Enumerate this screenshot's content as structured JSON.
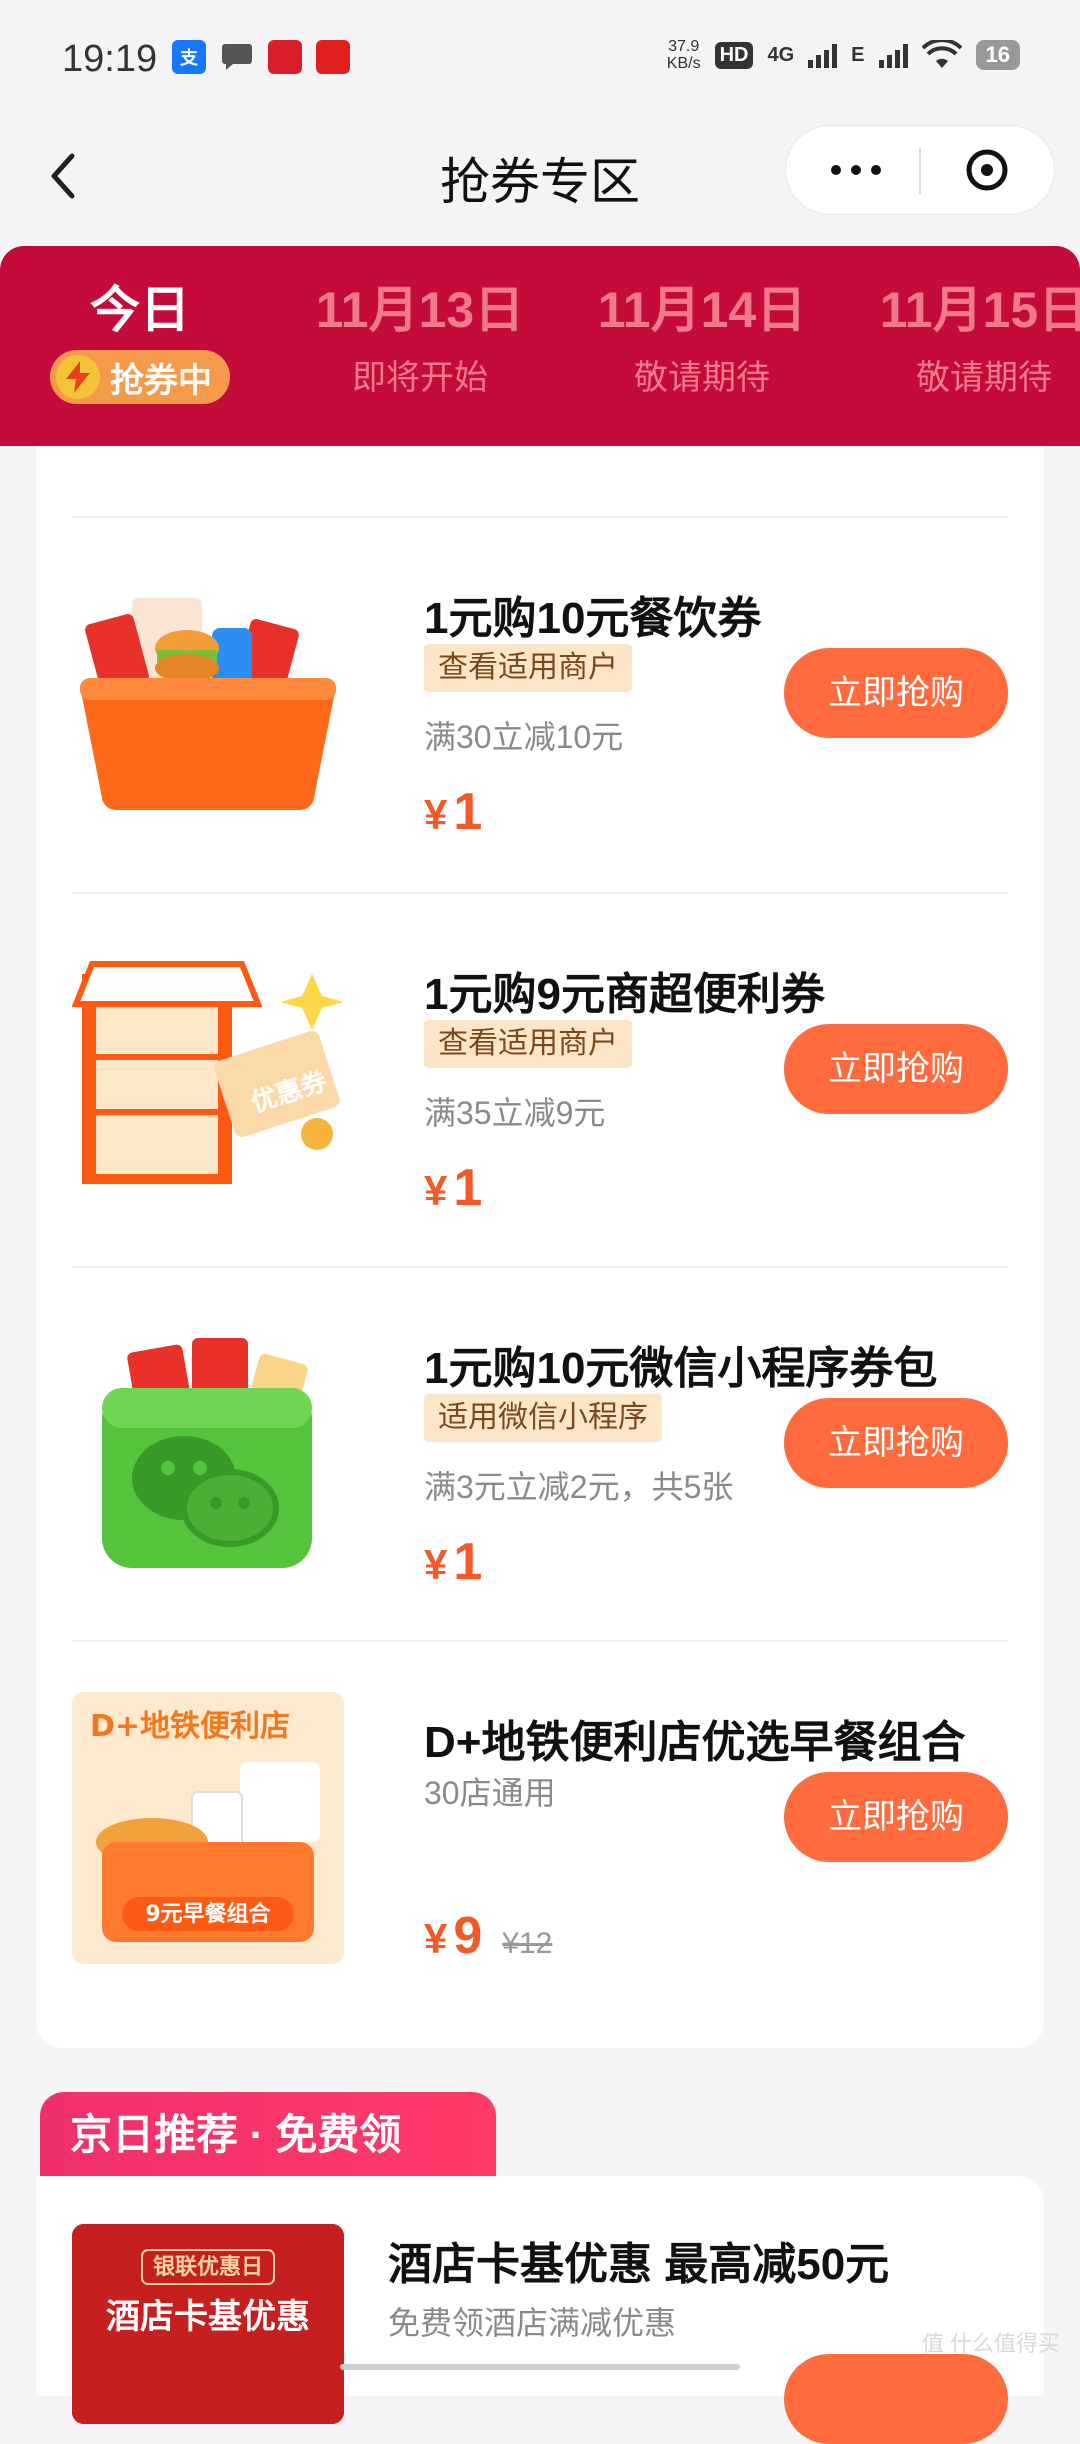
{
  "status_bar": {
    "time": "19:19",
    "net_speed_value": "37.9",
    "net_speed_unit": "KB/s",
    "hd_label": "HD",
    "network_4g": "4G",
    "network_e": "E",
    "battery": "16"
  },
  "nav": {
    "title": "抢券专区"
  },
  "date_tabs": [
    {
      "date": "今日",
      "sub": "抢券中",
      "active": true
    },
    {
      "date": "11月13日",
      "sub": "即将开始"
    },
    {
      "date": "11月14日",
      "sub": "敬请期待"
    },
    {
      "date": "11月15日",
      "sub": "敬请期待"
    }
  ],
  "coupons": [
    {
      "title": "1元购10元餐饮券",
      "tag": "查看适用商户",
      "desc": "满30立减10元",
      "currency": "¥",
      "price": "1",
      "button": "立即抢购"
    },
    {
      "title": "1元购9元商超便利券",
      "tag": "查看适用商户",
      "desc": "满35立减9元",
      "currency": "¥",
      "price": "1",
      "button": "立即抢购",
      "image_text": "优惠券"
    },
    {
      "title": "1元购10元微信小程序券包",
      "tag": "适用微信小程序",
      "desc": "满3元立减2元，共5张",
      "currency": "¥",
      "price": "1",
      "button": "立即抢购"
    },
    {
      "title": "D+地铁便利店优选早餐组合",
      "desc": "30店通用",
      "currency": "¥",
      "price": "9",
      "original_price": "¥12",
      "button": "立即抢购",
      "image_title": "D+地铁便利店",
      "image_caption": "9元早餐组合"
    }
  ],
  "section2": {
    "label": "京日推荐 · 免费领",
    "item": {
      "title": "酒店卡基优惠 最高减50元",
      "desc": "免费领酒店满减优惠",
      "image_title": "银联优惠日",
      "image_caption": "酒店卡基优惠"
    }
  },
  "watermark": "值 什么值得买"
}
